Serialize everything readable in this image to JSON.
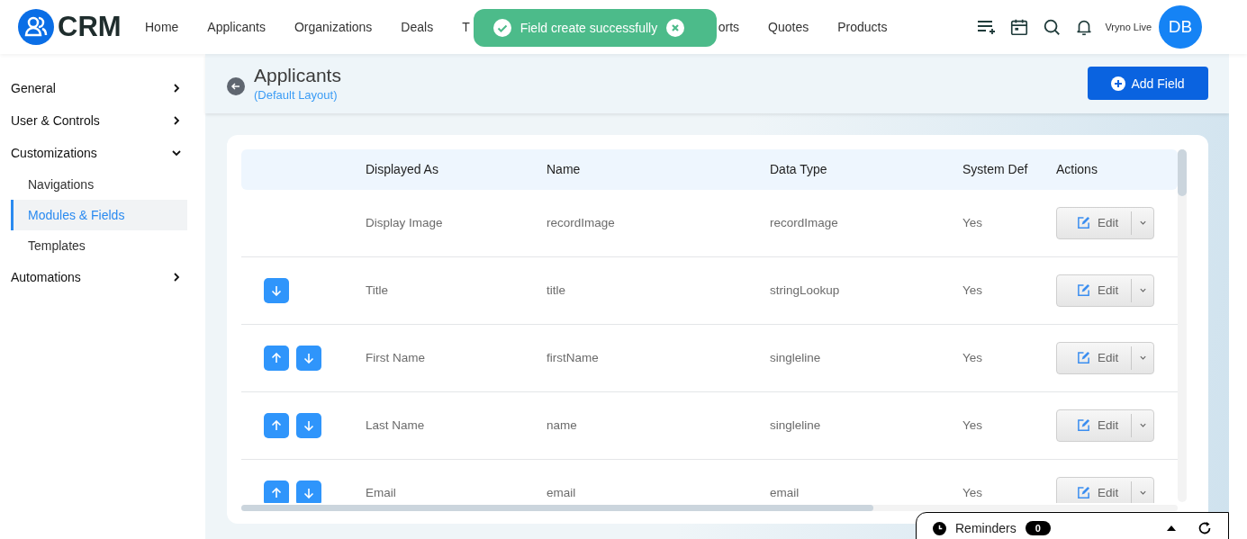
{
  "app": {
    "logo_text": "CRM"
  },
  "nav": [
    {
      "label": "Home"
    },
    {
      "label": "Applicants"
    },
    {
      "label": "Organizations"
    },
    {
      "label": "Deals"
    },
    {
      "label": "T"
    },
    {
      "label": "orts"
    },
    {
      "label": "Quotes"
    },
    {
      "label": "Products"
    }
  ],
  "toast": {
    "message": "Field create successfully"
  },
  "user": {
    "name": "Vryno Live",
    "initials": "DB"
  },
  "sidebar": [
    {
      "label": "General",
      "expanded": false
    },
    {
      "label": "User & Controls",
      "expanded": false
    },
    {
      "label": "Customizations",
      "expanded": true,
      "children": [
        {
          "label": "Navigations",
          "selected": false
        },
        {
          "label": "Modules & Fields",
          "selected": true
        },
        {
          "label": "Templates",
          "selected": false
        }
      ]
    },
    {
      "label": "Automations",
      "expanded": false
    }
  ],
  "page": {
    "title": "Applicants",
    "subtitle": "(Default Layout)",
    "add_button": "Add Field"
  },
  "table": {
    "columns": [
      "Displayed As",
      "Name",
      "Data Type",
      "System Def",
      "Actions"
    ],
    "rows": [
      {
        "move_up": false,
        "move_down": false,
        "displayed_as": "Display Image",
        "name": "recordImage",
        "data_type": "recordImage",
        "system_def": "Yes",
        "action": "Edit"
      },
      {
        "move_up": false,
        "move_down": true,
        "displayed_as": "Title",
        "name": "title",
        "data_type": "stringLookup",
        "system_def": "Yes",
        "action": "Edit"
      },
      {
        "move_up": true,
        "move_down": true,
        "displayed_as": "First Name",
        "name": "firstName",
        "data_type": "singleline",
        "system_def": "Yes",
        "action": "Edit"
      },
      {
        "move_up": true,
        "move_down": true,
        "displayed_as": "Last Name",
        "name": "name",
        "data_type": "singleline",
        "system_def": "Yes",
        "action": "Edit"
      },
      {
        "move_up": true,
        "move_down": true,
        "displayed_as": "Email",
        "name": "email",
        "data_type": "email",
        "system_def": "Yes",
        "action": "Edit"
      }
    ]
  },
  "reminders": {
    "label": "Reminders",
    "count": "0"
  }
}
